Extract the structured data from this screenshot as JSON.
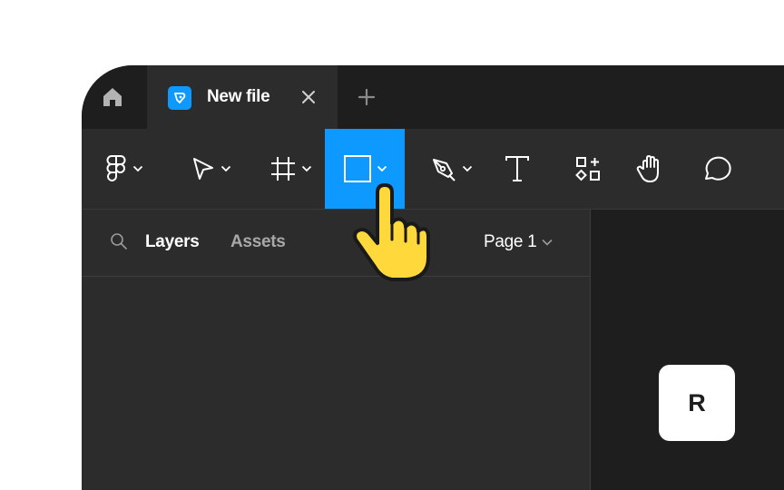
{
  "colors": {
    "accent": "#0d99ff",
    "tabbar_bg": "#1e1e1e",
    "panel_bg": "#2c2c2c",
    "canvas_bg": "#1e1e1e",
    "cursor_fill": "#ffd93b"
  },
  "tabs": {
    "home_icon": "home-icon",
    "active_tab": {
      "title": "New file",
      "icon": "figma-file-icon",
      "close_icon": "close-icon"
    },
    "new_tab_icon": "plus-icon"
  },
  "toolbar": {
    "tools": [
      {
        "name": "main-menu",
        "icon": "figma-logo-icon",
        "has_caret": true
      },
      {
        "name": "move-tool",
        "icon": "cursor-arrow-icon",
        "has_caret": true
      },
      {
        "name": "frame-tool",
        "icon": "frame-hash-icon",
        "has_caret": true
      },
      {
        "name": "rectangle-tool",
        "icon": "rectangle-icon",
        "has_caret": true,
        "active": true
      },
      {
        "name": "pen-tool",
        "icon": "pen-nib-icon",
        "has_caret": true
      },
      {
        "name": "text-tool",
        "icon": "text-t-icon"
      },
      {
        "name": "resources-tool",
        "icon": "shapes-icon"
      },
      {
        "name": "hand-tool",
        "icon": "hand-icon"
      },
      {
        "name": "comment-tool",
        "icon": "comment-bubble-icon"
      }
    ]
  },
  "layers_panel": {
    "tabs": [
      "Layers",
      "Assets"
    ],
    "active_tab": "Layers",
    "page": "Page 1"
  },
  "shortcut_key": "R"
}
